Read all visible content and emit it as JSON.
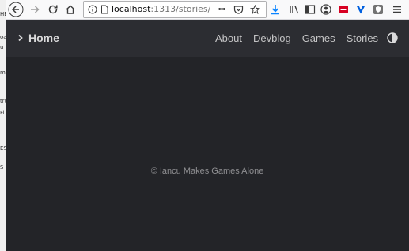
{
  "browser": {
    "url_host": "localhost",
    "url_path": ":1313/stories/",
    "url_more": "•••"
  },
  "site": {
    "home_label": "Home",
    "nav": [
      {
        "label": "About"
      },
      {
        "label": "Devblog"
      },
      {
        "label": "Games"
      },
      {
        "label": "Stories"
      }
    ],
    "footer": "© Iancu Makes Games Alone"
  },
  "background_window": {
    "fragments": [
      "HE",
      "oa",
      "u",
      "m",
      "tru",
      "Fi",
      "ES",
      "S"
    ]
  },
  "colors": {
    "page_bg": "#232428",
    "header_bg": "#2c2d32",
    "header_text": "#dadadb",
    "footer_text": "#8f8f92",
    "download_icon": "#0a84ff",
    "addon_red": "#d70022",
    "addon_blue": "#0060df"
  }
}
